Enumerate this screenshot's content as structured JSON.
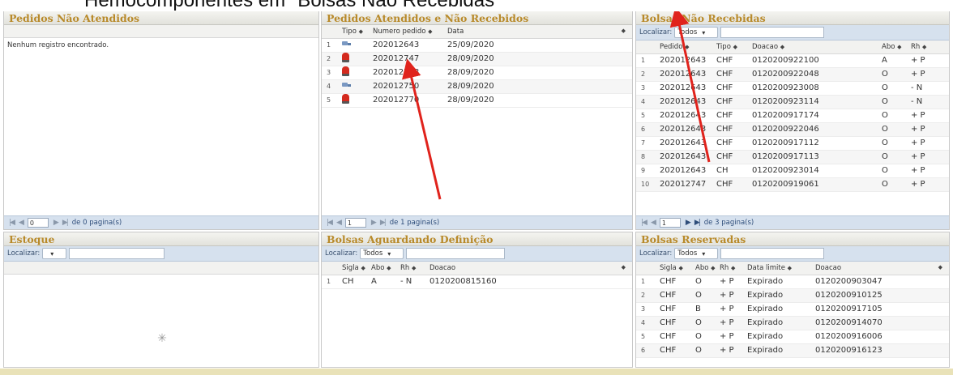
{
  "page_heading": "Hemocomponentes em \"Bolsas Não Recebidas\"",
  "colors": {
    "title": "#b88a2a",
    "bar": "#d6e1ee",
    "arrow": "#e0231c"
  },
  "icons": {
    "truck": "truck-icon",
    "siren": "siren-icon",
    "spinner": "loading-spinner-icon"
  },
  "panels": {
    "pedidos_nao_atendidos": {
      "title": "Pedidos Não Atendidos",
      "empty": "Nenhum registro encontrado.",
      "pager": {
        "page": "0",
        "text": "de 0 pagina(s)"
      }
    },
    "pedidos_atendidos": {
      "title": "Pedidos Atendidos e Não Recebidos",
      "columns": [
        "Tipo",
        "Numero pedido",
        "Data"
      ],
      "rows": [
        {
          "n": "1",
          "icon": "truck",
          "pedido": "202012643",
          "data": "25/09/2020"
        },
        {
          "n": "2",
          "icon": "siren",
          "pedido": "202012747",
          "data": "28/09/2020"
        },
        {
          "n": "3",
          "icon": "siren",
          "pedido": "202012748",
          "data": "28/09/2020"
        },
        {
          "n": "4",
          "icon": "truck",
          "pedido": "202012750",
          "data": "28/09/2020"
        },
        {
          "n": "5",
          "icon": "siren",
          "pedido": "202012770",
          "data": "28/09/2020"
        }
      ],
      "pager": {
        "page": "1",
        "text": "de 1 pagina(s)"
      }
    },
    "bolsas_nao_recebidas": {
      "title": "Bolsas Não Recebidas",
      "filter_label": "Localizar:",
      "filter_value": "Todos",
      "columns": [
        "Pedido",
        "Tipo",
        "Doacao",
        "Abo",
        "Rh"
      ],
      "rows": [
        [
          "1",
          "202012643",
          "CHF",
          "0120200922100",
          "A",
          "+ P"
        ],
        [
          "2",
          "202012643",
          "CHF",
          "0120200922048",
          "O",
          "+ P"
        ],
        [
          "3",
          "202012643",
          "CHF",
          "0120200923008",
          "O",
          "- N"
        ],
        [
          "4",
          "202012643",
          "CHF",
          "0120200923114",
          "O",
          "- N"
        ],
        [
          "5",
          "202012643",
          "CHF",
          "0120200917174",
          "O",
          "+ P"
        ],
        [
          "6",
          "202012643",
          "CHF",
          "0120200922046",
          "O",
          "+ P"
        ],
        [
          "7",
          "202012643",
          "CHF",
          "0120200917112",
          "O",
          "+ P"
        ],
        [
          "8",
          "202012643",
          "CHF",
          "0120200917113",
          "O",
          "+ P"
        ],
        [
          "9",
          "202012643",
          "CH",
          "0120200923014",
          "O",
          "+ P"
        ],
        [
          "10",
          "202012747",
          "CHF",
          "0120200919061",
          "O",
          "+ P"
        ]
      ],
      "pager": {
        "page": "1",
        "text": "de 3 pagina(s)"
      }
    },
    "estoque": {
      "title": "Estoque",
      "filter_label": "Localizar:",
      "filter_value": ""
    },
    "bolsas_aguardando": {
      "title": "Bolsas Aguardando Definição",
      "filter_label": "Localizar:",
      "filter_value": "Todos",
      "columns": [
        "Sigla",
        "Abo",
        "Rh",
        "Doacao"
      ],
      "rows": [
        [
          "1",
          "CH",
          "A",
          "- N",
          "0120200815160"
        ]
      ]
    },
    "bolsas_reservadas": {
      "title": "Bolsas Reservadas",
      "filter_label": "Localizar:",
      "filter_value": "Todos",
      "columns": [
        "Sigla",
        "Abo",
        "Rh",
        "Data limite",
        "Doacao"
      ],
      "rows": [
        [
          "1",
          "CHF",
          "O",
          "+ P",
          "Expirado",
          "0120200903047"
        ],
        [
          "2",
          "CHF",
          "O",
          "+ P",
          "Expirado",
          "0120200910125"
        ],
        [
          "3",
          "CHF",
          "B",
          "+ P",
          "Expirado",
          "0120200917105"
        ],
        [
          "4",
          "CHF",
          "O",
          "+ P",
          "Expirado",
          "0120200914070"
        ],
        [
          "5",
          "CHF",
          "O",
          "+ P",
          "Expirado",
          "0120200916006"
        ],
        [
          "6",
          "CHF",
          "O",
          "+ P",
          "Expirado",
          "0120200916123"
        ]
      ]
    }
  }
}
